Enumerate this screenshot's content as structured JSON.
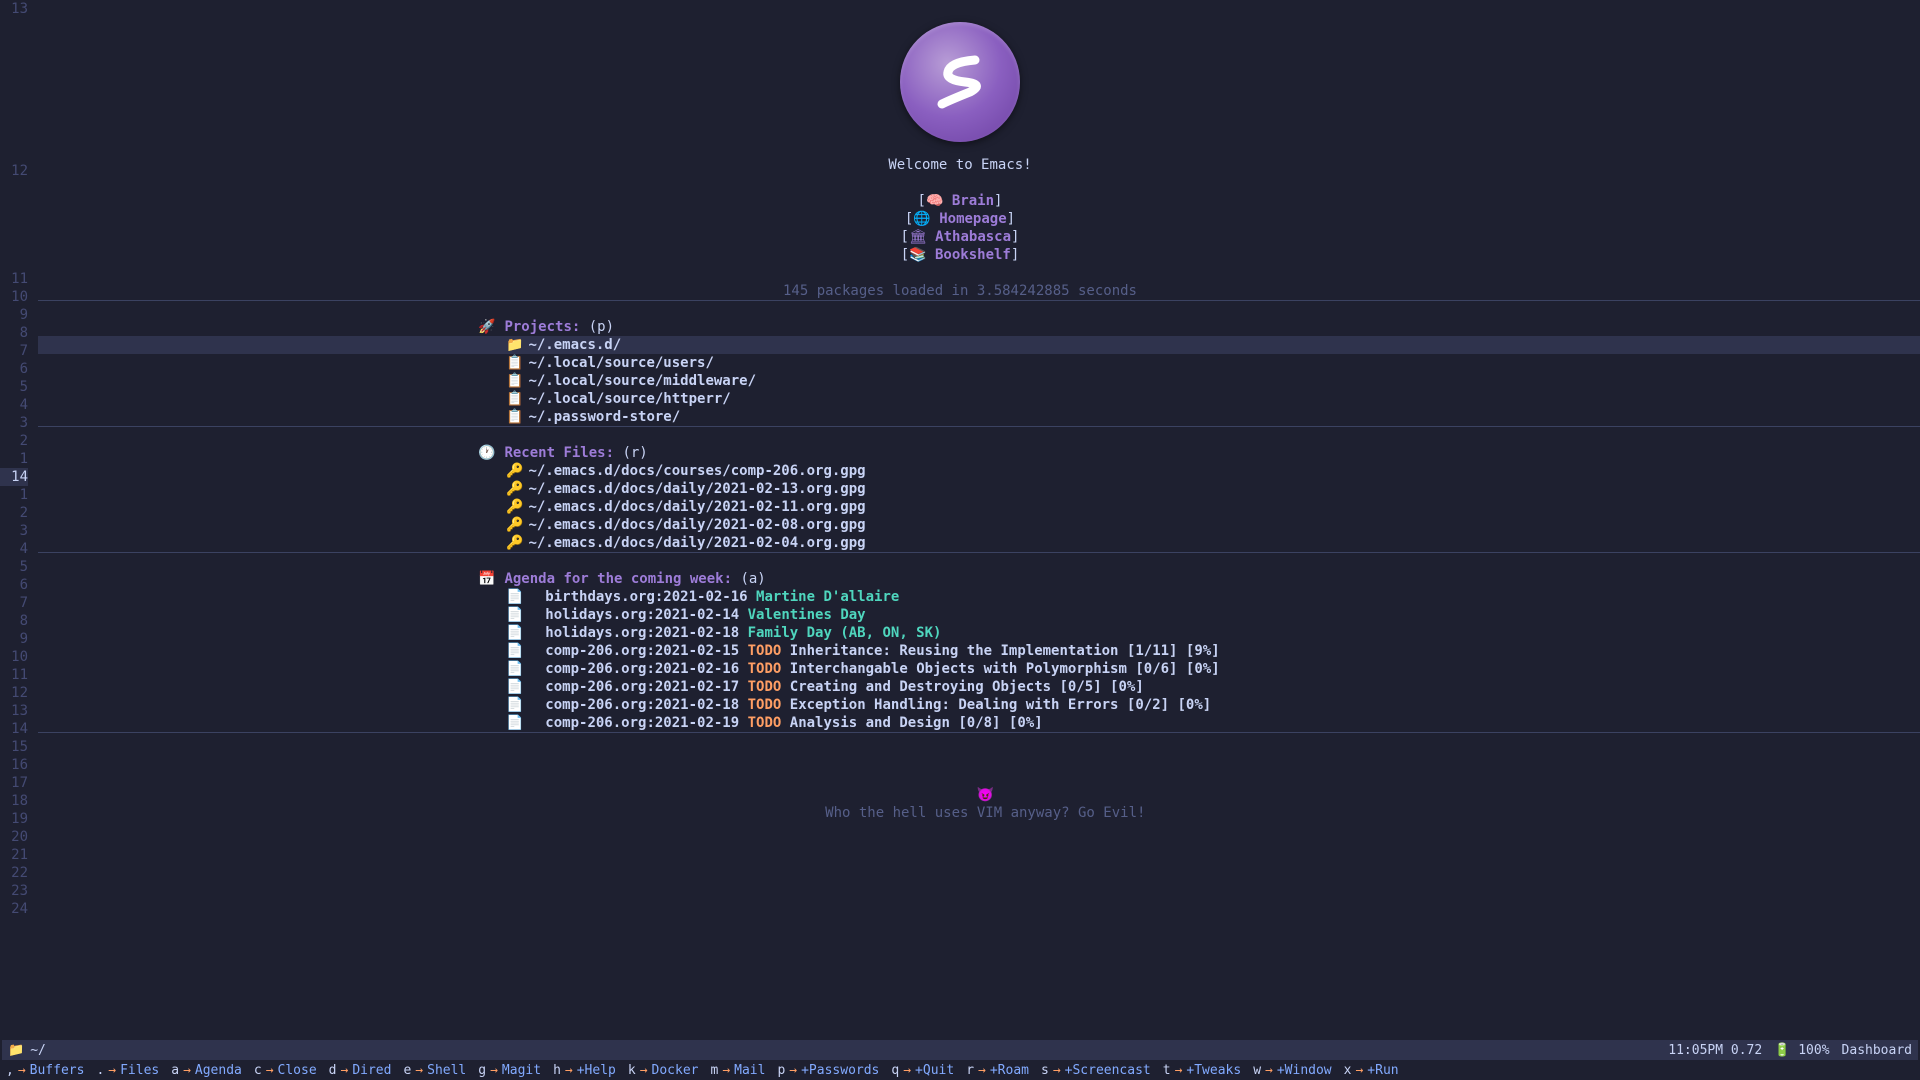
{
  "gutter": [
    "13",
    "",
    "",
    "",
    "",
    "",
    "",
    "",
    "",
    "12",
    "",
    "",
    "",
    "",
    "",
    "11",
    "10",
    "9",
    "8",
    "7",
    "6",
    "5",
    "4",
    "3",
    "2",
    "1",
    "14",
    "1",
    "2",
    "3",
    "4",
    "5",
    "6",
    "7",
    "8",
    "9",
    "10",
    "11",
    "12",
    "13",
    "14",
    "15",
    "16",
    "17",
    "18",
    "19",
    "20",
    "21",
    "22",
    "23",
    "24"
  ],
  "welcome": "Welcome to Emacs!",
  "nav": [
    {
      "icon": "🧠",
      "label": "Brain"
    },
    {
      "icon": "🌐",
      "label": "Homepage"
    },
    {
      "icon": "🏛",
      "label": "Athabasca"
    },
    {
      "icon": "📚",
      "label": "Bookshelf"
    }
  ],
  "packages": "145 packages loaded in 3.584242885 seconds",
  "sections": {
    "projects": {
      "icon": "🚀",
      "title": "Projects:",
      "shortcut": "(p)",
      "items": [
        {
          "icon": "📁",
          "text": "~/.emacs.d/"
        },
        {
          "icon": "📋",
          "text": "~/.local/source/users/"
        },
        {
          "icon": "📋",
          "text": "~/.local/source/middleware/"
        },
        {
          "icon": "📋",
          "text": "~/.local/source/httperr/"
        },
        {
          "icon": "📋",
          "text": "~/.password-store/"
        }
      ]
    },
    "recent": {
      "icon": "🕐",
      "title": "Recent Files:",
      "shortcut": "(r)",
      "items": [
        {
          "icon": "🔑",
          "text": "~/.emacs.d/docs/courses/comp-206.org.gpg"
        },
        {
          "icon": "🔑",
          "text": "~/.emacs.d/docs/daily/2021-02-13.org.gpg"
        },
        {
          "icon": "🔑",
          "text": "~/.emacs.d/docs/daily/2021-02-11.org.gpg"
        },
        {
          "icon": "🔑",
          "text": "~/.emacs.d/docs/daily/2021-02-08.org.gpg"
        },
        {
          "icon": "🔑",
          "text": "~/.emacs.d/docs/daily/2021-02-04.org.gpg"
        }
      ]
    },
    "agenda": {
      "icon": "📅",
      "title": "Agenda for the coming week:",
      "shortcut": "(a)",
      "items": [
        {
          "file": "birthdays.org:2021-02-16",
          "todo": "",
          "event": "Martine D'allaire",
          "desc": ""
        },
        {
          "file": "holidays.org:2021-02-14",
          "todo": "",
          "event": "Valentines Day",
          "desc": ""
        },
        {
          "file": "holidays.org:2021-02-18",
          "todo": "",
          "event": "Family Day (AB, ON, SK)",
          "desc": ""
        },
        {
          "file": "comp-206.org:2021-02-15",
          "todo": "TODO",
          "event": "",
          "desc": "Inheritance: Reusing the Implementation [1/11] [9%]"
        },
        {
          "file": "comp-206.org:2021-02-16",
          "todo": "TODO",
          "event": "",
          "desc": "Interchangable Objects with Polymorphism [0/6] [0%]"
        },
        {
          "file": "comp-206.org:2021-02-17",
          "todo": "TODO",
          "event": "",
          "desc": "Creating and Destroying Objects [0/5] [0%]"
        },
        {
          "file": "comp-206.org:2021-02-18",
          "todo": "TODO",
          "event": "",
          "desc": "Exception Handling: Dealing with Errors [0/2] [0%]"
        },
        {
          "file": "comp-206.org:2021-02-19",
          "todo": "TODO",
          "event": "",
          "desc": "Analysis and Design [0/8] [0%]"
        }
      ]
    }
  },
  "footer": "Who the hell uses VIM anyway? Go Evil!",
  "modeline": {
    "path": "~/",
    "time": "11:05PM",
    "load": "0.72",
    "battery": "100%",
    "mode": "Dashboard"
  },
  "keybar": [
    {
      "k": ",",
      "l": "Buffers"
    },
    {
      "k": ".",
      "l": "Files"
    },
    {
      "k": "a",
      "l": "Agenda"
    },
    {
      "k": "c",
      "l": "Close"
    },
    {
      "k": "d",
      "l": "Dired"
    },
    {
      "k": "e",
      "l": "Shell"
    },
    {
      "k": "g",
      "l": "Magit"
    },
    {
      "k": "h",
      "l": "+Help"
    },
    {
      "k": "k",
      "l": "Docker"
    },
    {
      "k": "m",
      "l": "Mail"
    },
    {
      "k": "p",
      "l": "+Passwords"
    },
    {
      "k": "q",
      "l": "+Quit"
    },
    {
      "k": "r",
      "l": "+Roam"
    },
    {
      "k": "s",
      "l": "+Screencast"
    },
    {
      "k": "t",
      "l": "+Tweaks"
    },
    {
      "k": "w",
      "l": "+Window"
    },
    {
      "k": "x",
      "l": "+Run"
    }
  ]
}
